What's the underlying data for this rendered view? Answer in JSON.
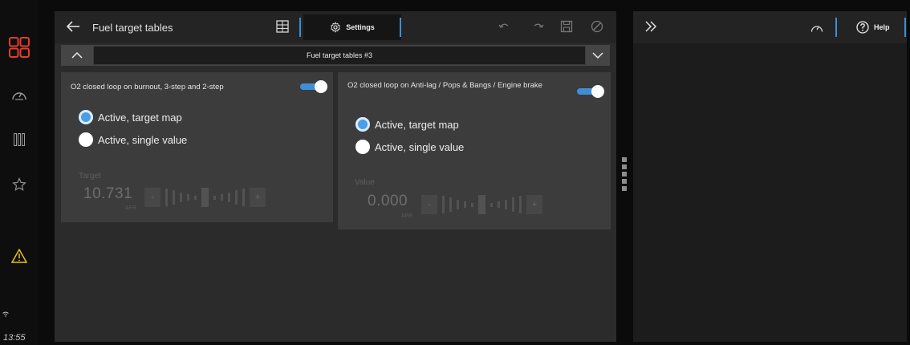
{
  "sidebar": {
    "time": "13:55",
    "items": [
      {
        "icon": "dashboard-grid-icon"
      },
      {
        "icon": "gauge-icon"
      },
      {
        "icon": "columns-icon"
      },
      {
        "icon": "star-icon"
      },
      {
        "icon": "warning-icon"
      },
      {
        "icon": "wifi-icon"
      }
    ]
  },
  "header": {
    "title": "Fuel target tables",
    "settings_label": "Settings"
  },
  "selector": {
    "value": "Fuel target tables #3"
  },
  "cards": [
    {
      "title": "O2 closed loop on burnout, 3-step and 2-step",
      "toggle_on": true,
      "options": [
        "Active, target map",
        "Active, single value"
      ],
      "selected": 0,
      "field_label": "Target",
      "value": "10.731",
      "unit": "AFR",
      "minus": "-",
      "plus": "+"
    },
    {
      "title": "O2 closed loop on Anti-lag / Pops & Bangs / Engine brake",
      "toggle_on": true,
      "options": [
        "Active, target map",
        "Active, single value"
      ],
      "selected": 0,
      "field_label": "Value",
      "value": "0.000",
      "unit": "AFR",
      "minus": "-",
      "plus": "+"
    }
  ],
  "right_panel": {
    "help_label": "Help"
  },
  "colors": {
    "accent": "#3f8fd8",
    "brand": "#e53b2c",
    "warning": "#e8c020"
  }
}
